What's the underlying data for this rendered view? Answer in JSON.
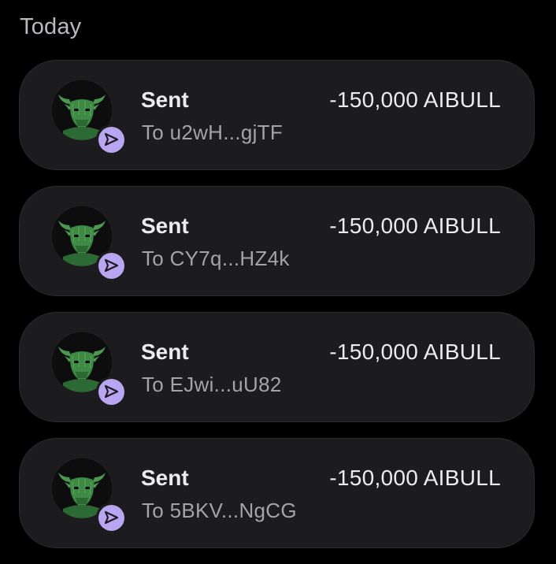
{
  "section": {
    "title": "Today"
  },
  "colors": {
    "background": "#000000",
    "card": "#1c1c1e",
    "badge": "#b9a6f3",
    "bull_green": "#4a9a4e"
  },
  "transactions": [
    {
      "title": "Sent",
      "recipient": "To u2wH...gjTF",
      "amount": "-150,000 AIBULL",
      "icon": "bull-token-avatar",
      "badge_icon": "send-arrow-icon"
    },
    {
      "title": "Sent",
      "recipient": "To CY7q...HZ4k",
      "amount": "-150,000 AIBULL",
      "icon": "bull-token-avatar",
      "badge_icon": "send-arrow-icon"
    },
    {
      "title": "Sent",
      "recipient": "To EJwi...uU82",
      "amount": "-150,000 AIBULL",
      "icon": "bull-token-avatar",
      "badge_icon": "send-arrow-icon"
    },
    {
      "title": "Sent",
      "recipient": "To 5BKV...NgCG",
      "amount": "-150,000 AIBULL",
      "icon": "bull-token-avatar",
      "badge_icon": "send-arrow-icon"
    }
  ]
}
